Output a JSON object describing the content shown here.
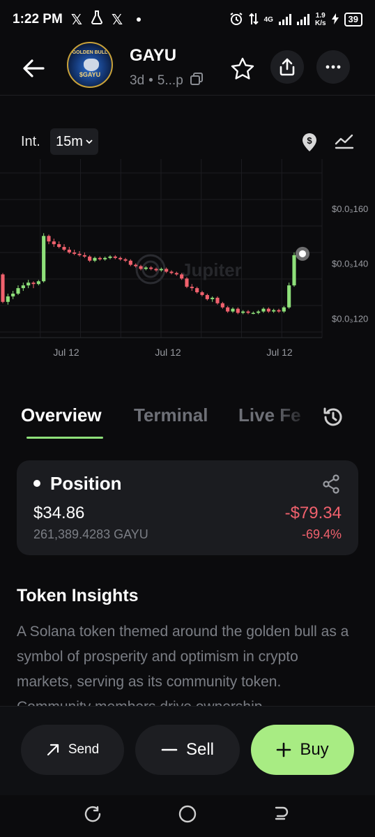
{
  "status_bar": {
    "time": "1:22 PM",
    "network": "4G",
    "speed_value": "1.9",
    "speed_unit": "K/s",
    "battery": "39"
  },
  "header": {
    "token_name": "GAYU",
    "token_age": "3d",
    "token_address": "5...p",
    "logo_top_text": "GOLDEN BULL",
    "logo_bottom_text": "$GAYU"
  },
  "interval": {
    "label": "Int.",
    "value": "15m"
  },
  "chart_data": {
    "type": "candlestick",
    "watermark": "Jupiter",
    "y_ticks": [
      {
        "label": "$0.0₃160",
        "value": 0.00016
      },
      {
        "label": "$0.0₃140",
        "value": 0.00014
      },
      {
        "label": "$0.0₃120",
        "value": 0.00012
      }
    ],
    "x_ticks": [
      "Jul 12",
      "Jul 12",
      "Jul 12"
    ],
    "ylim": [
      0.000113,
      0.000178
    ],
    "candles": [
      [
        0.000136,
        0.0001365,
        0.0001255,
        0.000126
      ],
      [
        0.000126,
        0.000129,
        0.000125,
        0.000128
      ],
      [
        0.000128,
        0.00013,
        0.000127,
        0.000129
      ],
      [
        0.000129,
        0.000132,
        0.0001285,
        0.000131
      ],
      [
        0.000131,
        0.000133,
        0.00013,
        0.000132
      ],
      [
        0.000132,
        0.000134,
        0.000131,
        0.000133
      ],
      [
        0.000133,
        0.0001335,
        0.000131,
        0.0001325
      ],
      [
        0.0001325,
        0.000134,
        0.000132,
        0.0001335
      ],
      [
        0.0001335,
        0.000151,
        0.000133,
        0.00015
      ],
      [
        0.00015,
        0.0001505,
        0.000147,
        0.000148
      ],
      [
        0.000148,
        0.000149,
        0.000146,
        0.000147
      ],
      [
        0.000147,
        0.000148,
        0.0001455,
        0.000146
      ],
      [
        0.000146,
        0.000147,
        0.0001445,
        0.000145
      ],
      [
        0.000145,
        0.000146,
        0.0001435,
        0.000144
      ],
      [
        0.000144,
        0.000145,
        0.000143,
        0.0001435
      ],
      [
        0.0001435,
        0.0001445,
        0.0001425,
        0.000143
      ],
      [
        0.000143,
        0.000144,
        0.000142,
        0.0001425
      ],
      [
        0.0001425,
        0.000143,
        0.0001405,
        0.000141
      ],
      [
        0.000141,
        0.0001425,
        0.0001405,
        0.000142
      ],
      [
        0.000142,
        0.0001425,
        0.000141,
        0.0001415
      ],
      [
        0.0001415,
        0.0001425,
        0.000141,
        0.000142
      ],
      [
        0.000142,
        0.000143,
        0.0001415,
        0.0001425
      ],
      [
        0.0001425,
        0.000143,
        0.0001415,
        0.000142
      ],
      [
        0.000142,
        0.0001425,
        0.000141,
        0.0001415
      ],
      [
        0.0001415,
        0.000142,
        0.0001405,
        0.000141
      ],
      [
        0.000141,
        0.0001415,
        0.000139,
        0.0001395
      ],
      [
        0.0001395,
        0.00014,
        0.0001385,
        0.000139
      ],
      [
        0.000139,
        0.0001395,
        0.0001375,
        0.000138
      ],
      [
        0.000138,
        0.000139,
        0.0001375,
        0.0001385
      ],
      [
        0.0001385,
        0.000139,
        0.0001375,
        0.000138
      ],
      [
        0.000138,
        0.0001385,
        0.000137,
        0.0001375
      ],
      [
        0.0001375,
        0.0001385,
        0.000137,
        0.000138
      ],
      [
        0.000138,
        0.0001385,
        0.0001365,
        0.000137
      ],
      [
        0.000137,
        0.0001375,
        0.000136,
        0.0001365
      ],
      [
        0.0001365,
        0.000137,
        0.0001355,
        0.000136
      ],
      [
        0.000136,
        0.0001365,
        0.000134,
        0.0001345
      ],
      [
        0.0001345,
        0.000135,
        0.000131,
        0.0001315
      ],
      [
        0.0001315,
        0.0001325,
        0.00013,
        0.000131
      ],
      [
        0.000131,
        0.0001315,
        0.000129,
        0.0001295
      ],
      [
        0.0001295,
        0.00013,
        0.000128,
        0.0001285
      ],
      [
        0.0001285,
        0.000129,
        0.0001265,
        0.000127
      ],
      [
        0.000127,
        0.000128,
        0.000126,
        0.0001275
      ],
      [
        0.0001275,
        0.000128,
        0.000125,
        0.0001255
      ],
      [
        0.0001255,
        0.000126,
        0.0001235,
        0.000124
      ],
      [
        0.000124,
        0.0001245,
        0.000122,
        0.0001225
      ],
      [
        0.0001225,
        0.000124,
        0.000122,
        0.0001235
      ],
      [
        0.0001235,
        0.000124,
        0.0001215,
        0.000122
      ],
      [
        0.000122,
        0.000123,
        0.0001215,
        0.0001225
      ],
      [
        0.0001225,
        0.000123,
        0.0001215,
        0.000122
      ],
      [
        0.000122,
        0.0001225,
        0.0001215,
        0.000122
      ],
      [
        0.000122,
        0.000123,
        0.0001215,
        0.0001225
      ],
      [
        0.0001225,
        0.000124,
        0.000122,
        0.0001235
      ],
      [
        0.0001235,
        0.000124,
        0.000122,
        0.0001225
      ],
      [
        0.0001225,
        0.0001235,
        0.000122,
        0.000123
      ],
      [
        0.000123,
        0.0001235,
        0.000122,
        0.0001225
      ],
      [
        0.0001225,
        0.0001245,
        0.000122,
        0.000124
      ],
      [
        0.000124,
        0.000133,
        0.0001235,
        0.000132
      ],
      [
        0.000132,
        0.000144,
        0.0001315,
        0.000143
      ]
    ]
  },
  "tabs": [
    {
      "label": "Overview",
      "active": true
    },
    {
      "label": "Terminal",
      "active": false
    },
    {
      "label": "Live Fe",
      "active": false
    }
  ],
  "position": {
    "title": "Position",
    "value": "$34.86",
    "amount": "261,389.4283 GAYU",
    "pnl": "-$79.34",
    "pnl_pct": "-69.4%"
  },
  "insights": {
    "title": "Token Insights",
    "text": "A Solana token themed around the golden bull as a symbol of prosperity and optimism in crypto markets, serving as its community token. Community members drive ownership"
  },
  "actions": {
    "send": "Send",
    "sell": "Sell",
    "buy": "Buy"
  },
  "colors": {
    "up": "#8ee07a",
    "down": "#f0616d",
    "buy": "#a8ec83",
    "background": "#0b0b0d"
  }
}
